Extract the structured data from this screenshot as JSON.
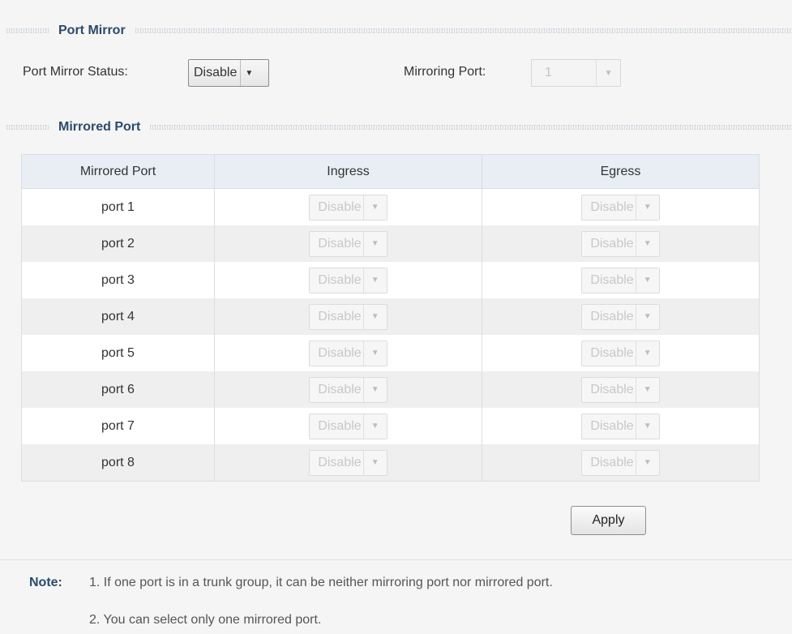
{
  "port_mirror": {
    "title": "Port Mirror",
    "status_label": "Port Mirror Status:",
    "status_value": "Disable",
    "mirroring_port_label": "Mirroring Port:",
    "mirroring_port_value": "1"
  },
  "mirrored_port": {
    "title": "Mirrored Port",
    "columns": [
      "Mirrored Port",
      "Ingress",
      "Egress"
    ],
    "rows": [
      {
        "port": "port 1",
        "ingress": "Disable",
        "egress": "Disable"
      },
      {
        "port": "port 2",
        "ingress": "Disable",
        "egress": "Disable"
      },
      {
        "port": "port 3",
        "ingress": "Disable",
        "egress": "Disable"
      },
      {
        "port": "port 4",
        "ingress": "Disable",
        "egress": "Disable"
      },
      {
        "port": "port 5",
        "ingress": "Disable",
        "egress": "Disable"
      },
      {
        "port": "port 6",
        "ingress": "Disable",
        "egress": "Disable"
      },
      {
        "port": "port 7",
        "ingress": "Disable",
        "egress": "Disable"
      },
      {
        "port": "port 8",
        "ingress": "Disable",
        "egress": "Disable"
      }
    ]
  },
  "apply_label": "Apply",
  "note": {
    "label": "Note:",
    "items": [
      "1. If one port is in a trunk group, it can be neither mirroring port nor mirrored port.",
      "2. You can select only one mirrored port."
    ]
  },
  "colors": {
    "section_title": "#2c4a6b",
    "header_bg": "#e8eef3"
  },
  "icons": {
    "dropdown": "chevron-down-icon"
  }
}
